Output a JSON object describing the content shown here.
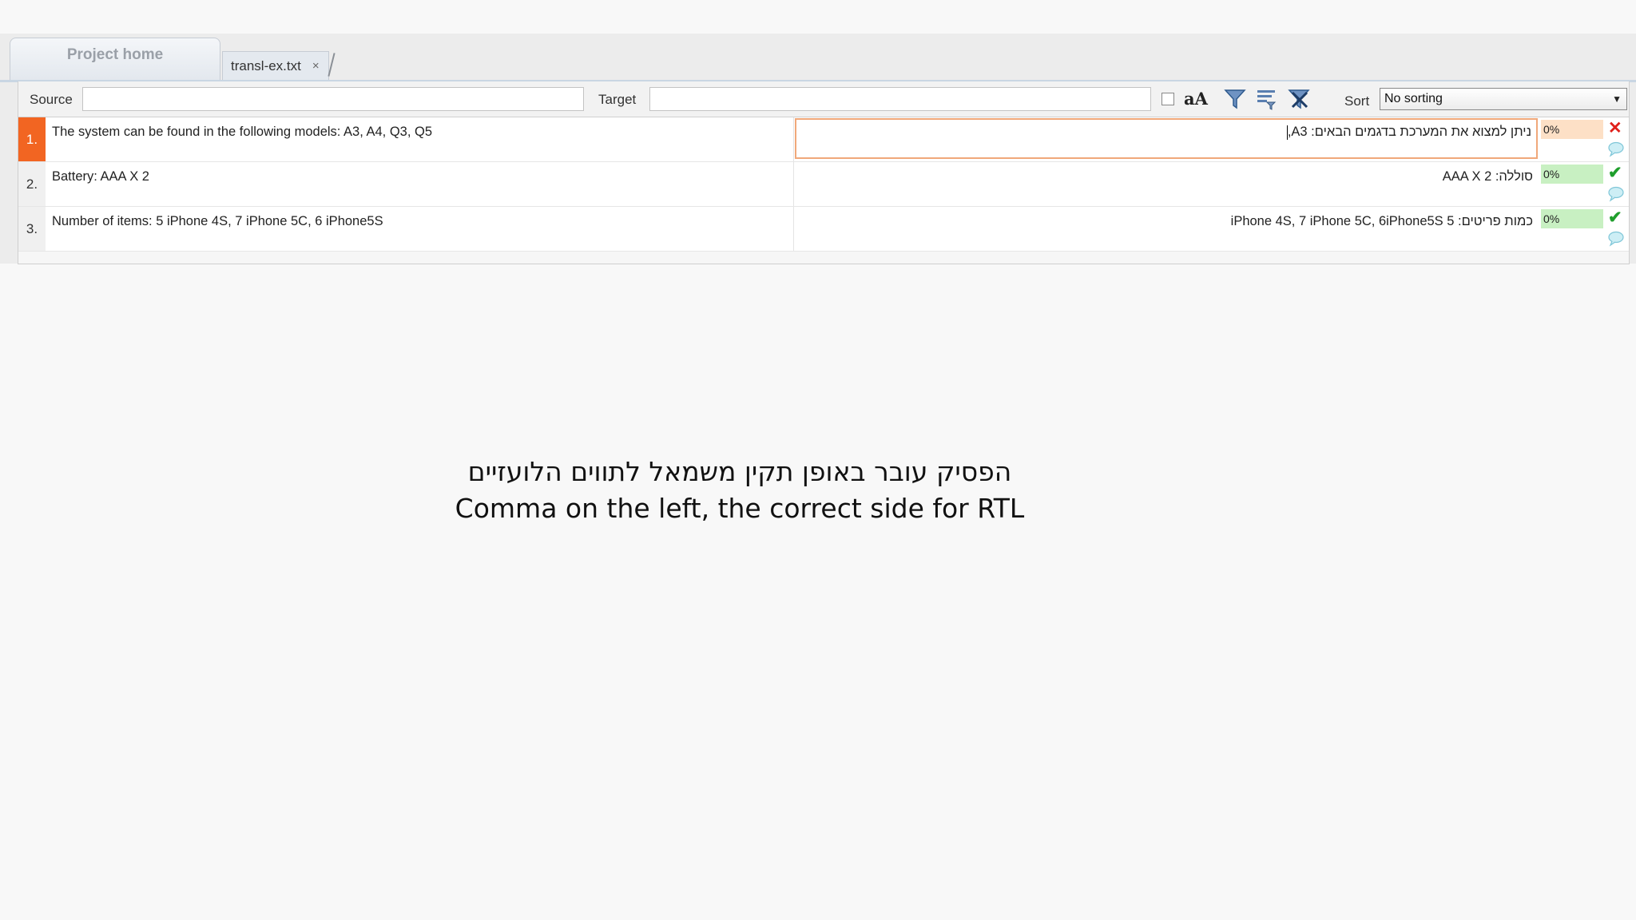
{
  "tabs": {
    "home_label": "Project home",
    "file_label": "transl-ex.txt",
    "close_glyph": "×"
  },
  "filter": {
    "source_label": "Source",
    "source_value": "",
    "target_label": "Target",
    "target_value": "",
    "case_label": "aA",
    "sort_label": "Sort",
    "sort_value": "No sorting"
  },
  "segments": [
    {
      "num": "1.",
      "source": "The system can be found in the following models: A3, A4, Q3, Q5",
      "target": "ניתן למצוא את המערכת בדגמים הבאים: A3,",
      "match": "0%",
      "status": "error",
      "status_glyph": "✕"
    },
    {
      "num": "2.",
      "source": "Battery: AAA X 2",
      "target": "סוללה: AAA X 2",
      "match": "0%",
      "status": "ok",
      "status_glyph": "✔"
    },
    {
      "num": "3.",
      "source": "Number of items: 5 iPhone 4S, 7 iPhone 5C, 6 iPhone5S",
      "target": "כמות פריטים: 5 iPhone 4S, 7 iPhone 5C, 6iPhone5S",
      "match": "0%",
      "status": "ok",
      "status_glyph": "✔"
    }
  ],
  "caption": {
    "line1": "הפסיק עובר באופן תקין משמאל לתווים הלועזיים",
    "line2": "Comma on the left, the correct side for RTL"
  },
  "colors": {
    "active_row": "#f26522",
    "error": "#e0201a",
    "ok": "#1f9e2c"
  }
}
